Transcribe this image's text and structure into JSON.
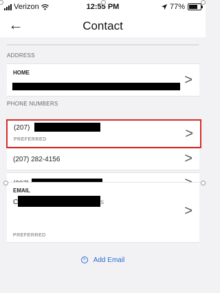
{
  "status_bar": {
    "carrier": "Verizon",
    "time": "12:55 PM",
    "battery_text": "77%",
    "battery_level": 0.77,
    "wifi_icon": "wifi-icon",
    "location_icon": "location-arrow-icon"
  },
  "header": {
    "back_icon": "←",
    "title": "Contact"
  },
  "address": {
    "section_label": "ADDRESS",
    "home_label": "HOME",
    "chevron": ">"
  },
  "phones": {
    "section_label": "PHONE NUMBERS",
    "items": [
      {
        "number": "(207)",
        "badge": "PREFERRED",
        "chevron": ">"
      },
      {
        "number": "(207) 282-4156",
        "chevron": ">"
      },
      {
        "number": "(207)",
        "chevron": ">"
      }
    ]
  },
  "email": {
    "label": "EMAIL",
    "badge": "PREFERRED",
    "visible_prefix": "C",
    "visible_suffix": "s",
    "chevron": ">"
  },
  "add_email": {
    "icon": "⊕",
    "label": "Add Email"
  },
  "colors": {
    "accent": "#2b6cd6",
    "selection_border": "#d62b2b",
    "background": "#f2f2f4"
  }
}
